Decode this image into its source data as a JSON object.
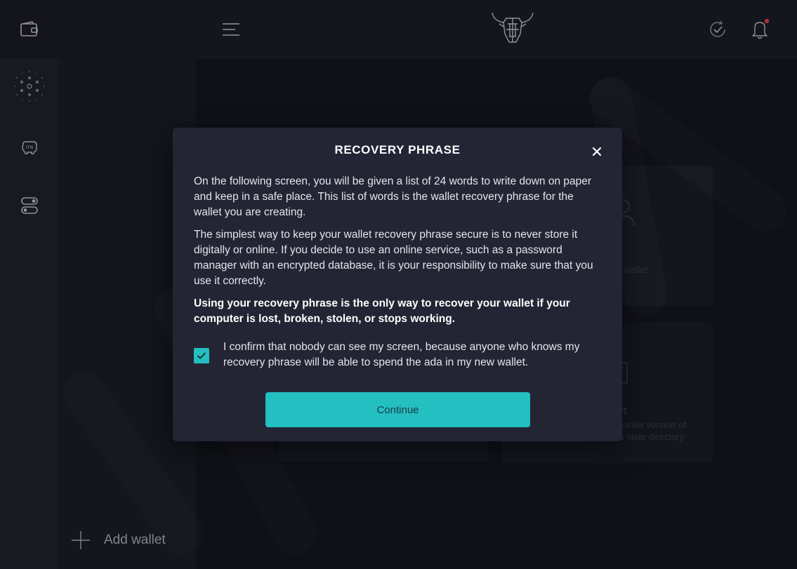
{
  "sidebar": {
    "add_wallet_label": "Add wallet",
    "icons": [
      "wallet-icon",
      "network-icon",
      "itn-icon",
      "settings-toggle-icon"
    ]
  },
  "background_content": {
    "card_fragment_1": "wallet",
    "card_fragment_2": "rt",
    "card_fragment_3": "earlier version of",
    "card_fragment_4": "us state directory"
  },
  "modal": {
    "title": "RECOVERY PHRASE",
    "paragraph_1": "On the following screen, you will be given a list of 24 words to write down on paper and keep in a safe place. This list of words is the wallet recovery phrase for the wallet you are creating.",
    "paragraph_2": "The simplest way to keep your wallet recovery phrase secure is to never store it digitally or online. If you decide to use an online service, such as a password manager with an encrypted database, it is your responsibility to make sure that you use it correctly.",
    "paragraph_3": "Using your recovery phrase is the only way to recover your wallet if your computer is lost, broken, stolen, or stops working.",
    "confirm_label": "I confirm that nobody can see my screen, because anyone who knows my recovery phrase will be able to spend the ada in my new wallet.",
    "confirm_checked": true,
    "continue_label": "Continue"
  },
  "colors": {
    "accent": "#23bfc1",
    "modal_bg": "#232535",
    "rail_bg": "#22242f",
    "notification_dot": "#e34b4b"
  }
}
